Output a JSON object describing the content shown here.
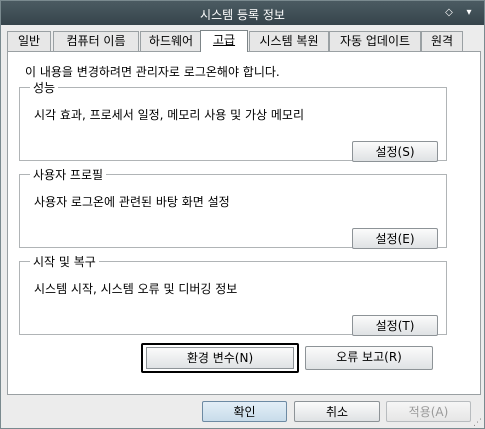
{
  "window": {
    "title": "시스템 등록 정보",
    "help_icon": "◇",
    "menu_icon": "▾"
  },
  "tabs": [
    {
      "label": "일반"
    },
    {
      "label": "컴퓨터 이름"
    },
    {
      "label": "하드웨어"
    },
    {
      "label": "고급",
      "active": true
    },
    {
      "label": "시스템 복원"
    },
    {
      "label": "자동 업데이트"
    },
    {
      "label": "원격"
    }
  ],
  "panel": {
    "notice": "이 내용을 변경하려면 관리자로 로그온해야 합니다.",
    "groups": [
      {
        "title": "성능",
        "description": "시각 효과, 프로세서 일정, 메모리 사용 및 가상 메모리",
        "button": "설정(S)"
      },
      {
        "title": "사용자 프로필",
        "description": "사용자 로그온에 관련된 바탕 화면 설정",
        "button": "설정(E)"
      },
      {
        "title": "시작 및 복구",
        "description": "시스템 시작, 시스템 오류 및 디버깅 정보",
        "button": "설정(T)"
      }
    ],
    "env_button": "환경 변수(N)",
    "error_button": "오류 보고(R)"
  },
  "footer": {
    "ok": "확인",
    "cancel": "취소",
    "apply": "적용(A)"
  },
  "colors": {
    "titlebar": "#3f4e55",
    "panel_bg": "#ffffff",
    "window_bg": "#ececec",
    "ok_accent": "#c8dcea"
  }
}
